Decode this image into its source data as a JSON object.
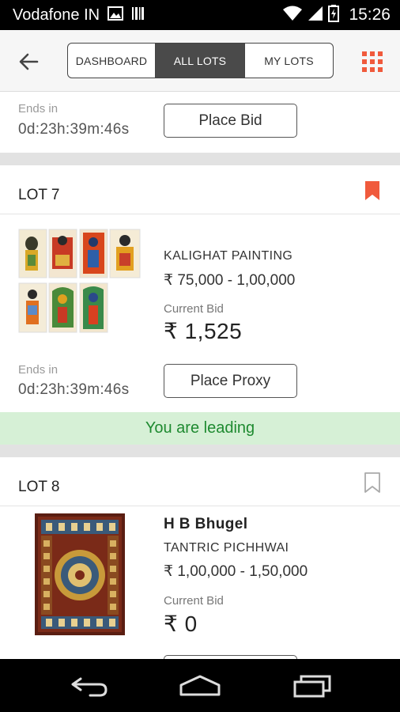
{
  "status_bar": {
    "carrier": "Vodafone IN",
    "time": "15:26"
  },
  "app_bar": {
    "tabs": [
      {
        "label": "DASHBOARD",
        "active": false
      },
      {
        "label": "ALL LOTS",
        "active": true
      },
      {
        "label": "MY LOTS",
        "active": false
      }
    ],
    "accent_color": "#f05a3c"
  },
  "lots": [
    {
      "ends_label": "Ends in",
      "timer": "0d:23h:39m:46s",
      "action_label": "Place Bid"
    },
    {
      "lot_label": "LOT 7",
      "bookmarked": true,
      "title": "KALIGHAT PAINTING",
      "estimate": "₹ 75,000 -  1,00,000",
      "current_bid_label": "Current Bid",
      "current_bid": "₹  1,525",
      "ends_label": "Ends in",
      "timer": "0d:23h:39m:46s",
      "action_label": "Place Proxy",
      "status_banner": "You are leading"
    },
    {
      "lot_label": "LOT 8",
      "bookmarked": false,
      "artist": "H B Bhugel",
      "title": "TANTRIC PICHHWAI",
      "estimate": "₹ 1,00,000 -  1,50,000",
      "current_bid_label": "Current Bid",
      "current_bid": "₹ 0"
    }
  ],
  "colors": {
    "leading_bg": "#d6f0d6",
    "leading_text": "#1e8a30",
    "bookmark_active": "#f05a3c"
  }
}
